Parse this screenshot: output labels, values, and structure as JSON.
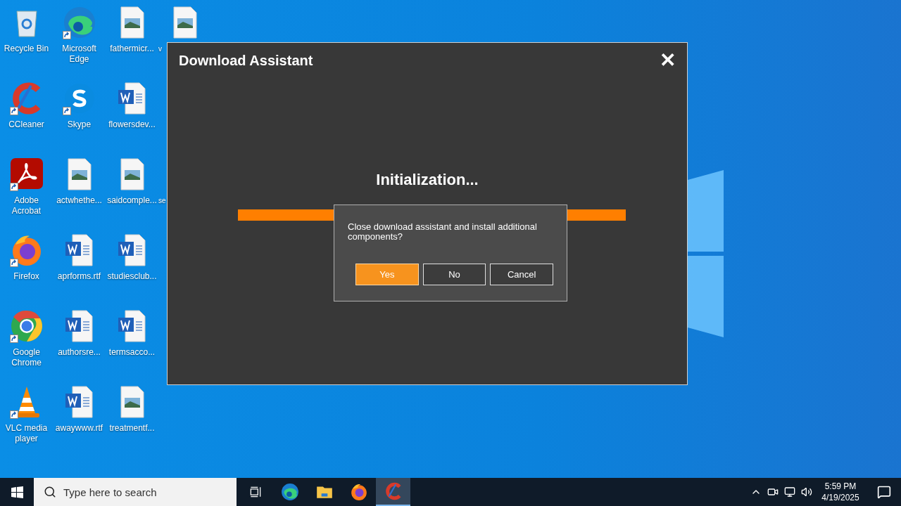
{
  "desktop": {
    "columns": [
      [
        {
          "label": "Recycle Bin",
          "kind": "recycle",
          "shortcut": false
        },
        {
          "label": "CCleaner",
          "kind": "ccleaner",
          "shortcut": true
        },
        {
          "label": "Adobe Acrobat",
          "kind": "acrobat",
          "shortcut": true
        },
        {
          "label": "Firefox",
          "kind": "firefox",
          "shortcut": true
        },
        {
          "label": "Google Chrome",
          "kind": "chrome",
          "shortcut": true
        },
        {
          "label": "VLC media player",
          "kind": "vlc",
          "shortcut": true
        }
      ],
      [
        {
          "label": "Microsoft Edge",
          "kind": "edge",
          "shortcut": true
        },
        {
          "label": "Skype",
          "kind": "skype",
          "shortcut": true
        },
        {
          "label": "actwhethe...",
          "kind": "image",
          "shortcut": false
        },
        {
          "label": "aprforms.rtf",
          "kind": "word",
          "shortcut": false
        },
        {
          "label": "authorsre...",
          "kind": "word",
          "shortcut": false
        },
        {
          "label": "awaywww.rtf",
          "kind": "word",
          "shortcut": false
        }
      ],
      [
        {
          "label": "fathermicr...",
          "kind": "image",
          "shortcut": false
        },
        {
          "label": "flowersdev...",
          "kind": "word",
          "shortcut": false
        },
        {
          "label": "saidcomple...",
          "kind": "image",
          "shortcut": false
        },
        {
          "label": "studiesclub...",
          "kind": "word",
          "shortcut": false
        },
        {
          "label": "termsacco...",
          "kind": "word",
          "shortcut": false
        },
        {
          "label": "treatmentf...",
          "kind": "image",
          "shortcut": false
        }
      ],
      [
        {
          "label": "v",
          "kind": "image",
          "shortcut": false
        },
        {
          "kind": "blank"
        },
        {
          "label": "se",
          "kind": "covered"
        }
      ]
    ]
  },
  "window": {
    "title": "Download Assistant",
    "close": "✕",
    "status": "Initialization...",
    "progress": {
      "level": 1
    }
  },
  "prompt": {
    "message": "Close download assistant and install additional components?",
    "buttons": [
      {
        "label": "Yes",
        "default": true
      },
      {
        "label": "No",
        "default": false
      },
      {
        "label": "Cancel",
        "default": false
      }
    ]
  },
  "taskbar": {
    "search": {
      "placeholder": "Type here to search"
    },
    "apps": [
      {
        "kind": "taskview",
        "active": false
      },
      {
        "kind": "edge",
        "active": false
      },
      {
        "kind": "explorer",
        "active": false
      },
      {
        "kind": "firefox",
        "active": false
      },
      {
        "kind": "ccleaner",
        "active": true
      }
    ],
    "clock": {
      "time": "5:59 PM",
      "date": "4/19/2025"
    }
  }
}
